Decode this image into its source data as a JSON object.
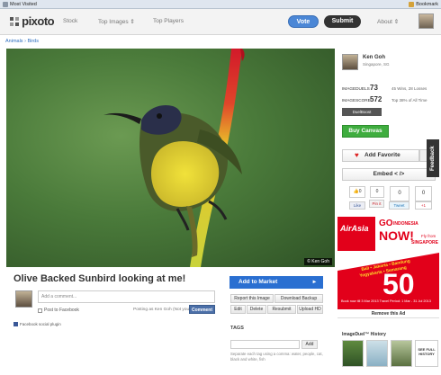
{
  "bookmarks_bar": {
    "most_visited": "Most Visited",
    "right": "Bookmark"
  },
  "nav": {
    "logo": "pixoto",
    "stock": "Stock",
    "top_images": "Top Images ⇕",
    "top_players": "Top Players",
    "vote": "Vote",
    "submit": "Submit",
    "about": "About ⇕"
  },
  "breadcrumb": "Animals › Birds",
  "photo": {
    "copyright": "© Ken Goh"
  },
  "image_title": "Olive Backed Sunbird looking at me!",
  "comment": {
    "placeholder": "Add a comment...",
    "post_to_facebook": "Post to Facebook",
    "posting_as": "Posting as Ken Goh (Not you?)",
    "button": "Comment",
    "fb_plugin": "Facebook social plugin"
  },
  "actions": {
    "add_to_market": "Add to Market",
    "report": "Report this Image",
    "download": "Download Backup",
    "edit": "Edit",
    "delete": "Delete",
    "resubmit": "Resubmit",
    "upload_hd": "Upload HD"
  },
  "tags": {
    "label": "TAGS",
    "add": "Add",
    "hint": "Separate each tag using a comma: water, people, cat, black and white, fish"
  },
  "author": {
    "name": "Ken Goh",
    "location": "Singapore, SG"
  },
  "stats": {
    "duels_label": "IMAGEDUELS",
    "duels_value": "73",
    "duels_detail": "45 Wins, 28 Losses",
    "score_label": "IMAGESCORE",
    "score_value": "572",
    "score_detail": "Top 38% of All Time",
    "duelboost": "DuelBoost"
  },
  "buy_canvas": "Buy Canvas",
  "add_favorite": "Add Favorite",
  "embed": "Embed < />",
  "feedback": "Feedback",
  "social": {
    "fb_count": "0",
    "like": "Like",
    "pin_count": "0",
    "pin": "Pin it",
    "tweet_count": "0",
    "tweet": "Tweet",
    "plus_count": "0",
    "plus": "+1"
  },
  "ad": {
    "brand": "AirAsia",
    "go": "GO",
    "indonesia": "INDONESIA",
    "now": "NOW!",
    "fly_from": "Fly from",
    "singapore": "SINGAPORE",
    "price": "50",
    "dest1": "Bali • Jakarta • Bandung",
    "dest2": "Yogyakarta • Semarang",
    "fine": "Book now till 3 Mar 2013 Travel Period: 1 Mar - 31 Jul 2013",
    "remove": "Remove this Ad"
  },
  "history": {
    "title": "ImageDuel™ History",
    "extra": "SEE FULL HISTORY"
  },
  "colors": {
    "accent": "#2a6fd1",
    "canvas_green": "#3fad3f",
    "ad_red": "#e2001a"
  }
}
